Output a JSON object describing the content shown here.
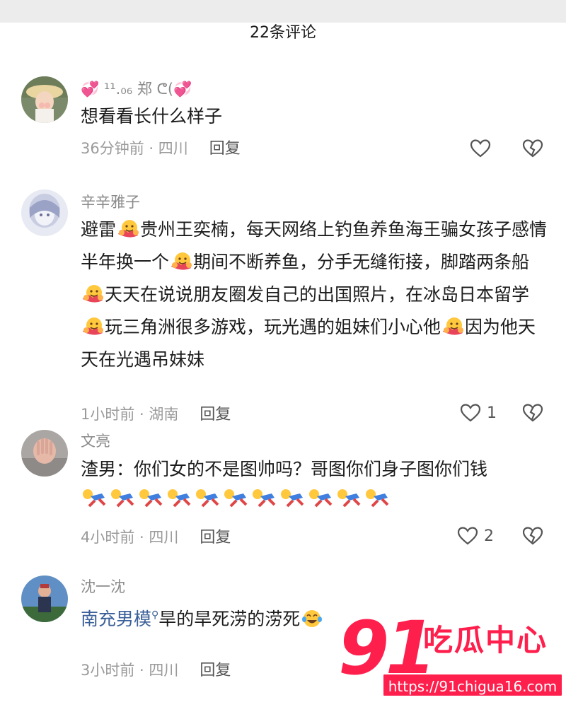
{
  "header": {
    "title": "22条评论"
  },
  "comments": [
    {
      "user": "💞 ¹¹.₀₆ 郑 ᕦ(💞",
      "text": "想看看长什么样子",
      "time_loc": "36分钟前 · 四川",
      "reply": "回复",
      "likes": ""
    },
    {
      "user": "辛辛雅子",
      "lines": [
        "避雷",
        "贵州王奕楠，每天网络上钓鱼养鱼海王骗女孩子感情半年换一个",
        "期间不断养鱼，分手无缝衔接，脚踏两条船",
        "天天在说说朋友圈发自己的出国照片，在冰岛日本留学",
        "玩三角洲很多游戏，玩光遇的姐妹们小心他",
        "因为他天天在光遇吊妹妹"
      ],
      "time_loc": "1小时前 · 湖南",
      "reply": "回复",
      "likes": "1"
    },
    {
      "user": "文亮",
      "text": "渣男：你们女的不是图帅吗？哥图你们身子图你们钱",
      "time_loc": "4小时前 · 四川",
      "reply": "回复",
      "likes": "2"
    },
    {
      "user": "沈一沈",
      "link": "南充男模",
      "text": "旱的旱死涝的涝死",
      "time_loc": "3小时前 · 四川",
      "reply": "回复",
      "likes": ""
    }
  ],
  "watermark": {
    "number": "91",
    "name": "吃瓜中心",
    "url": "https://91chigua16.com"
  },
  "colors": {
    "accent": "#ff1f4d",
    "link": "#3b5f99",
    "meta": "#9a9a9a"
  }
}
